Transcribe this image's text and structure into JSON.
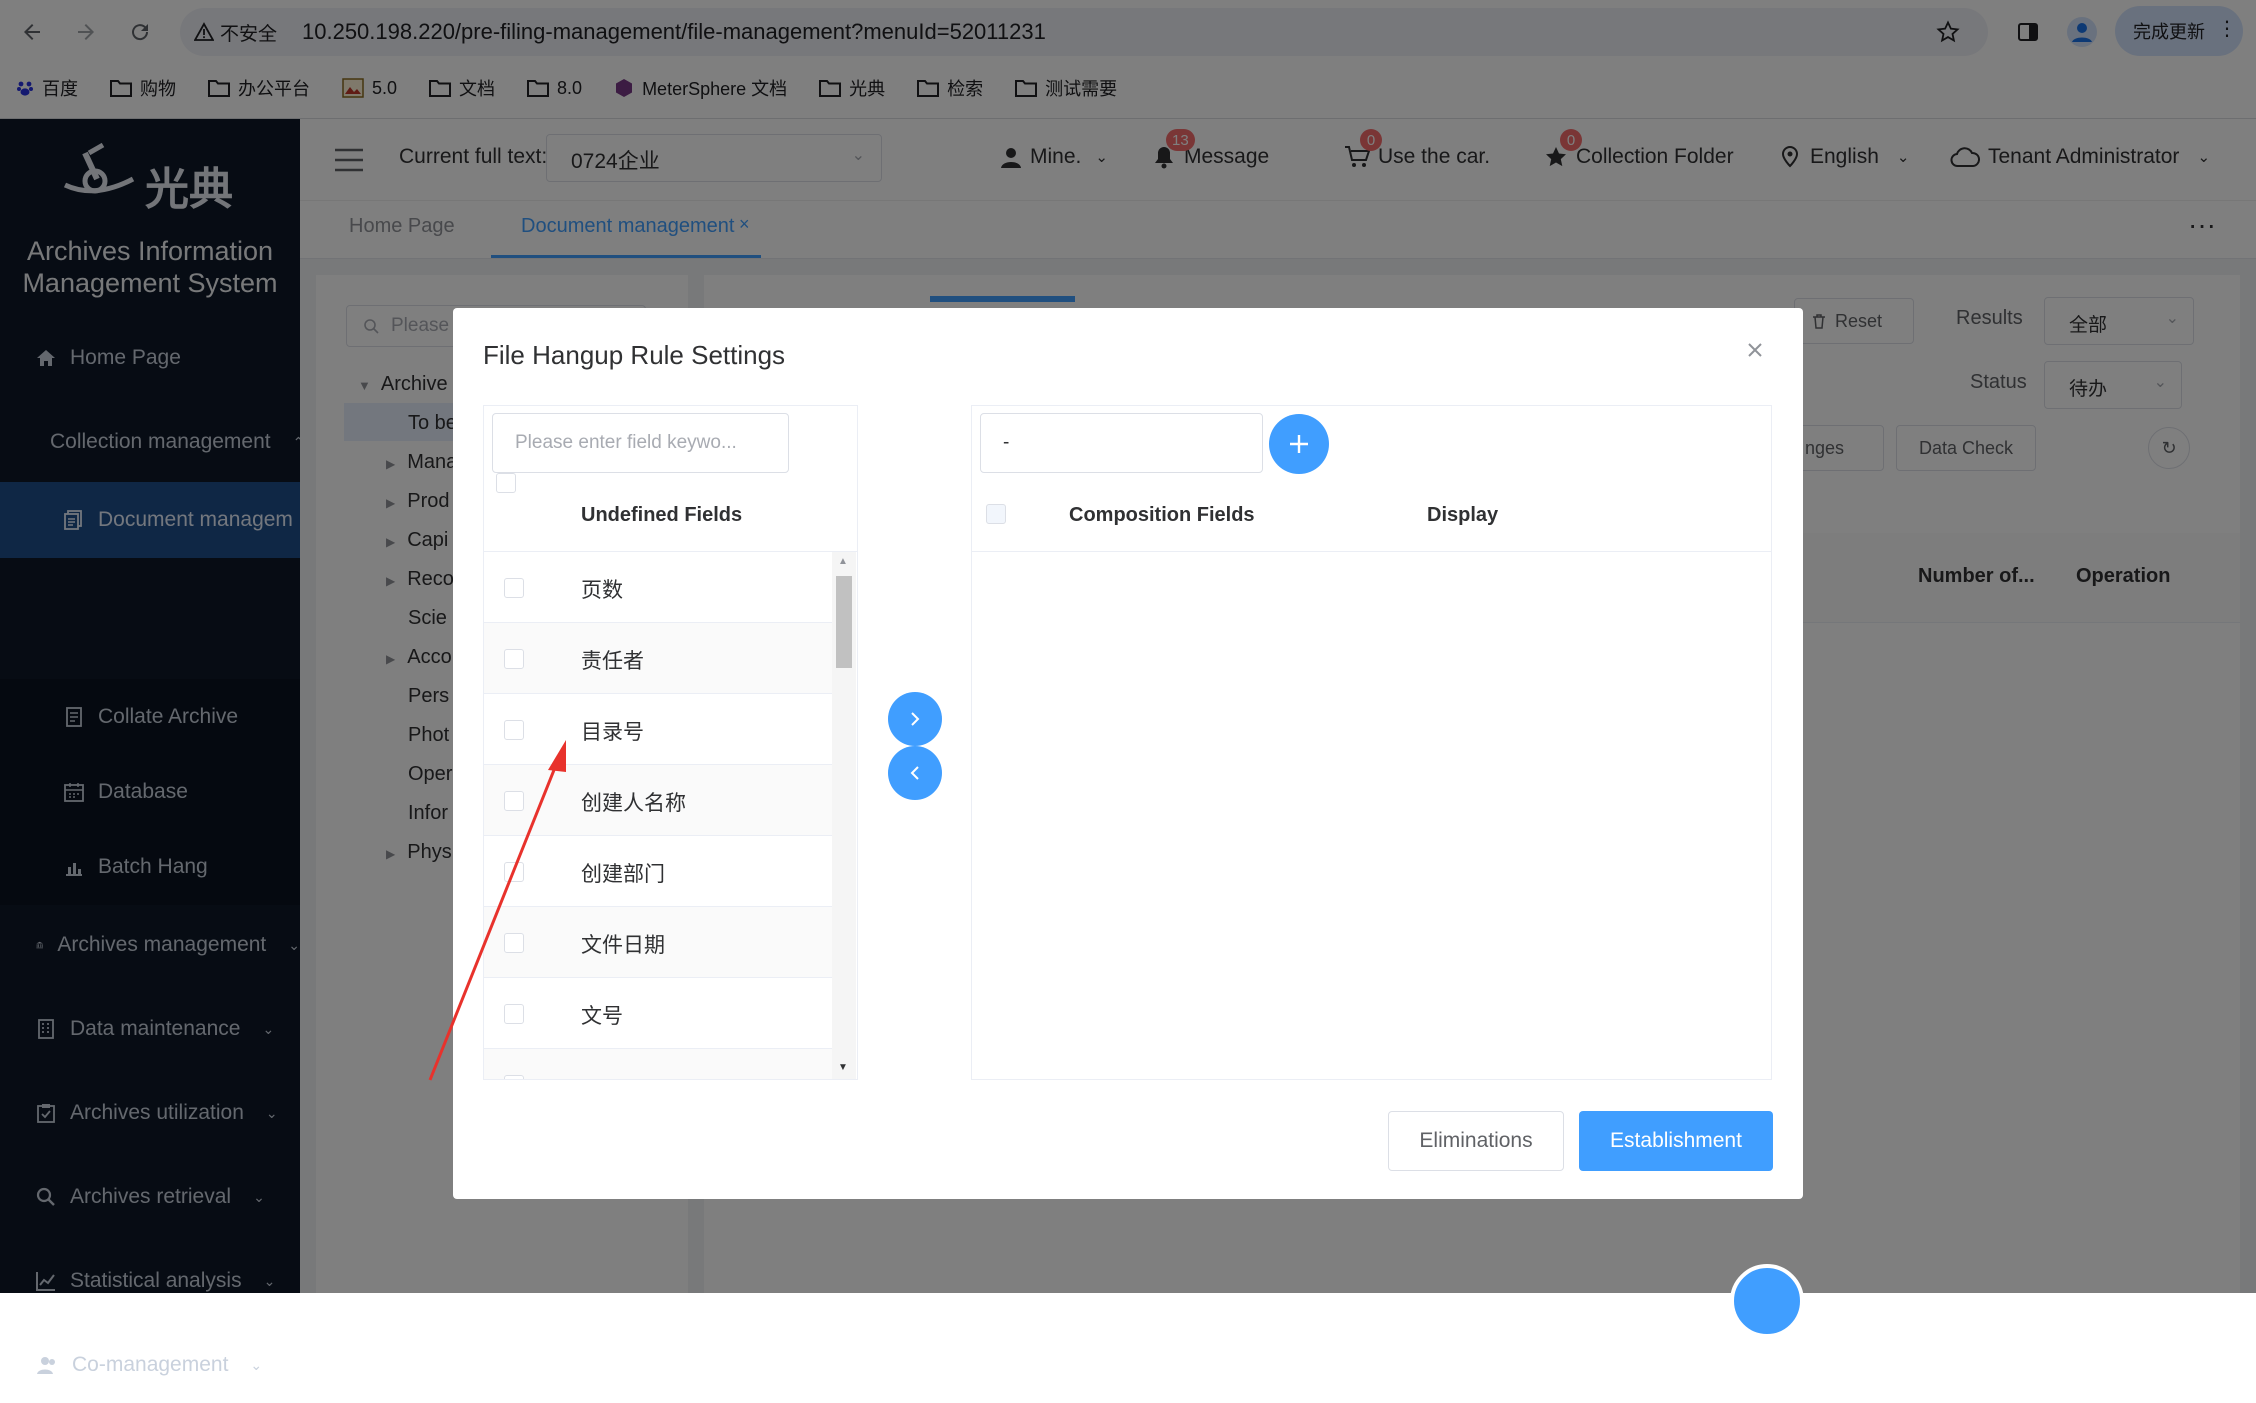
{
  "browser": {
    "security_label": "不安全",
    "url": "10.250.198.220/pre-filing-management/file-management?menuId=52011231",
    "update_label": "完成更新",
    "bookmarks": [
      "百度",
      "购物",
      "办公平台",
      "5.0",
      "文档",
      "8.0",
      "MeterSphere 文档",
      "光典",
      "检索",
      "测试需要"
    ]
  },
  "sidebar": {
    "logo_text": "光典",
    "system_title_line1": "Archives Information",
    "system_title_line2": "Management System",
    "items": [
      {
        "label": "Home Page"
      },
      {
        "label": "Collection management"
      },
      {
        "label": "Document managem"
      },
      {
        "label": "Collate Archive"
      },
      {
        "label": "Database"
      },
      {
        "label": "Batch Hang"
      },
      {
        "label": "Archives management"
      },
      {
        "label": "Data maintenance"
      },
      {
        "label": "Archives utilization"
      },
      {
        "label": "Archives retrieval"
      },
      {
        "label": "Statistical analysis"
      },
      {
        "label": "Co-management"
      }
    ]
  },
  "header": {
    "fulltext_label": "Current full text:",
    "fulltext_value": "0724企业",
    "mine": "Mine.",
    "message": "Message",
    "message_count": "13",
    "car": "Use the car.",
    "car_count": "0",
    "folder": "Collection Folder",
    "folder_count": "0",
    "language": "English",
    "role": "Tenant Administrator"
  },
  "tabs": {
    "home": "Home Page",
    "document": "Document management"
  },
  "background": {
    "search_placeholder": "Please",
    "tree_root": "Archive",
    "tree_items": [
      "To be",
      "Mana",
      "Prod",
      "Capi",
      "Reco",
      "Scie",
      "Acco",
      "Pers",
      "Phot",
      "Oper",
      "Infor",
      "Phys"
    ],
    "reset": "Reset",
    "results_label": "Results",
    "results_value": "全部",
    "status_label": "Status",
    "status_value": "待办",
    "changes_btn": "nges",
    "data_check": "Data Check",
    "col_number": "Number of...",
    "col_operation": "Operation",
    "col_trunc": "..."
  },
  "dialog": {
    "title": "File Hangup Rule Settings",
    "left_search_placeholder": "Please enter field keywo...",
    "left_header": "Undefined Fields",
    "left_rows": [
      "页数",
      "责任者",
      "目录号",
      "创建人名称",
      "创建部门",
      "文件日期",
      "文号"
    ],
    "right_input_value": "-",
    "right_header_fields": "Composition Fields",
    "right_header_display": "Display",
    "cancel": "Eliminations",
    "confirm": "Establishment"
  },
  "colors": {
    "primary": "#409eff",
    "sidebar_bg": "#0e1929",
    "sidebar_active": "#1f4f8a",
    "annotation_arrow": "#e8322c",
    "badge": "#f56c6c"
  }
}
